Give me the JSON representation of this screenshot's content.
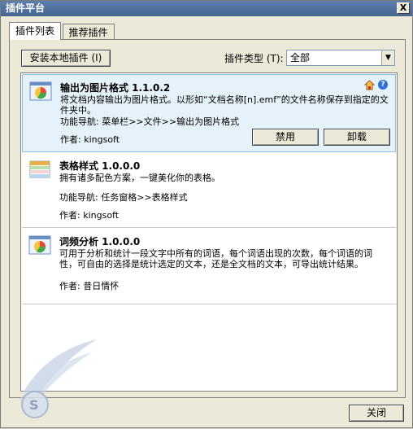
{
  "window": {
    "title": "插件平台",
    "close_glyph": "X"
  },
  "tabs": [
    {
      "label": "插件列表",
      "active": true
    },
    {
      "label": "推荐插件",
      "active": false
    }
  ],
  "toolbar": {
    "install_label": "安装本地插件 (I)",
    "type_label": "插件类型 (T):",
    "type_value": "全部"
  },
  "plugins": [
    {
      "name": "输出为图片格式  1.1.0.2",
      "description": "将文档内容输出为图片格式。以形如“文档名称[n].emf”的文件名称保存到指定的文件夹中。",
      "nav": "功能导航: 菜单栏>>文件>>输出为图片格式",
      "author": "作者: kingsoft",
      "icon": "chart-document-icon",
      "selected": true,
      "disable_label": "禁用",
      "uninstall_label": "卸载"
    },
    {
      "name": "表格样式  1.0.0.0",
      "description": "拥有诸多配色方案，一键美化你的表格。",
      "nav": "功能导航: 任务窗格>>表格样式",
      "author": "作者: kingsoft",
      "icon": "table-style-icon"
    },
    {
      "name": "词频分析  1.0.0.0",
      "description": "可用于分析和统计一段文字中所有的词语，每个词语出现的次数，每个词语的词性，可自由的选择是统计选定的文本，还是全文档的文本，可导出统计结果。",
      "author": "作者: 昔日情怀",
      "icon": "chart-document-icon"
    }
  ],
  "footer": {
    "close_label": "关闭"
  }
}
